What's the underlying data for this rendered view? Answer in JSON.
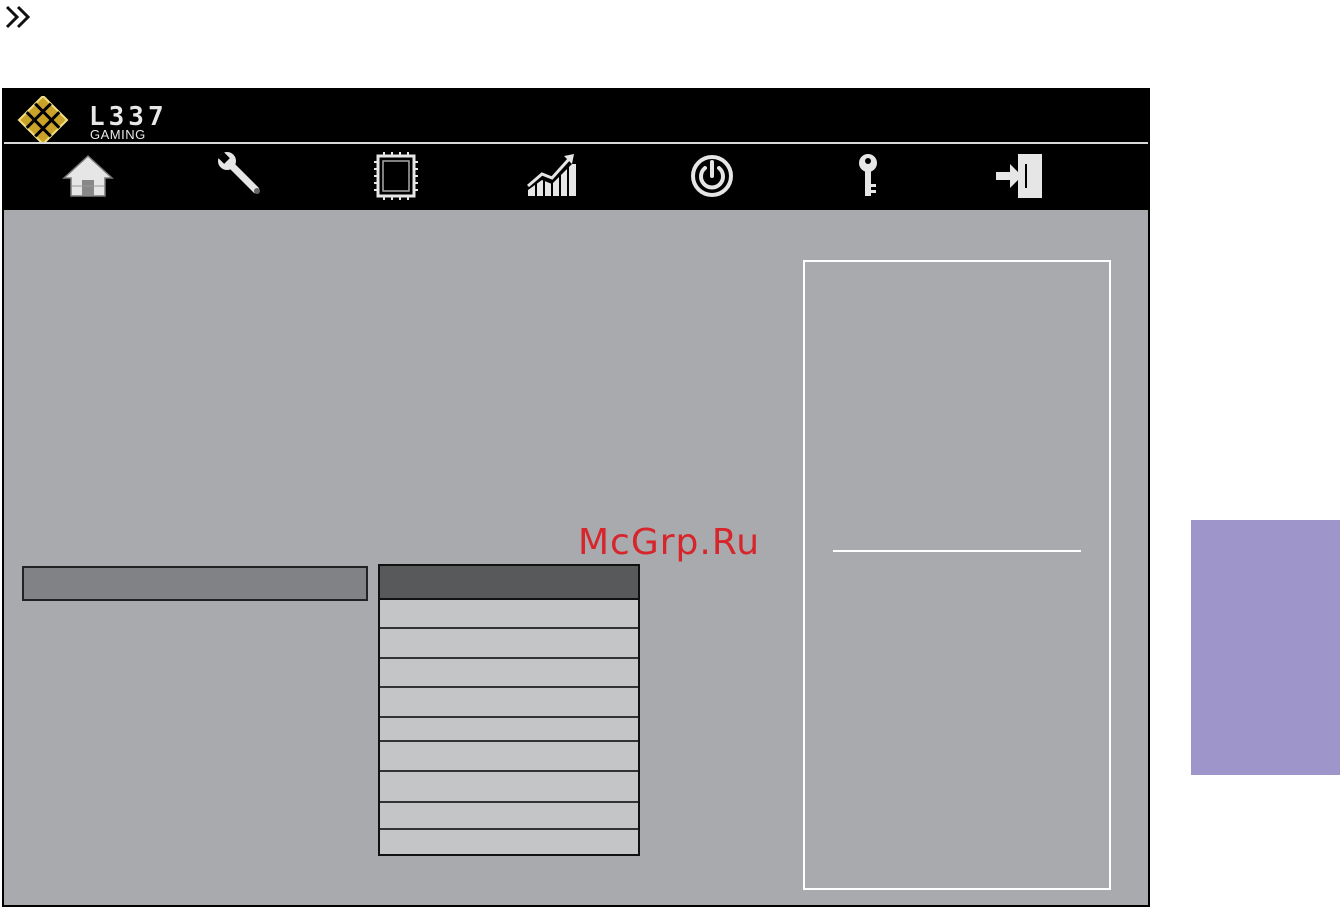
{
  "brand": {
    "name": "L337",
    "sub": "GAMING"
  },
  "nav": {
    "items": [
      {
        "id": "home",
        "icon": "home-icon"
      },
      {
        "id": "tools",
        "icon": "wrench-icon"
      },
      {
        "id": "chipset",
        "icon": "chip-icon"
      },
      {
        "id": "performance",
        "icon": "chart-icon"
      },
      {
        "id": "power",
        "icon": "power-icon"
      },
      {
        "id": "security",
        "icon": "key-icon"
      },
      {
        "id": "exit",
        "icon": "exit-icon"
      }
    ]
  },
  "watermark": "McGrp.Ru",
  "colors": {
    "panel_bg": "#a9aaad",
    "header_bg": "#000000",
    "list_row": "#c4c5c7",
    "list_head": "#58595b",
    "side_tab": "#9e96cb",
    "watermark": "#d6262b"
  }
}
